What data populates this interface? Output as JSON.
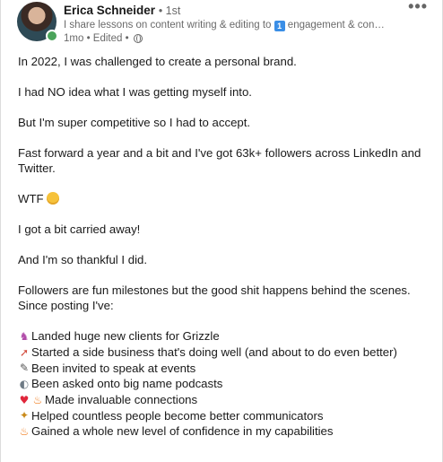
{
  "author": {
    "name": "Erica Schneider",
    "degree": "• 1st",
    "headline_prefix": "I share lessons on content writing & editing to ",
    "headline_badge": "1",
    "headline_suffix": " engagement & conver...",
    "timestamp": "1mo • Edited •",
    "more_label": "•••"
  },
  "post": {
    "paragraphs": [
      "In 2022, I was challenged to create a personal brand.",
      "I had NO idea what I was getting myself into.",
      "But I'm super competitive so I had to accept.",
      "Fast forward a year and a bit and I've got 63k+ followers across LinkedIn and Twitter.",
      "WTF",
      "I got a bit carried away!",
      "And I'm so thankful I did.",
      "Followers are fun milestones but the good shit happens behind the scenes. Since posting I've:"
    ],
    "list": [
      {
        "icon": "unicorn-icon",
        "text": "Landed huge new clients for Grizzle"
      },
      {
        "icon": "rocket-icon",
        "text": "Started a side business that's doing well (and about to do even better)"
      },
      {
        "icon": "microphone-icon",
        "text": "Been invited to speak at events"
      },
      {
        "icon": "podcast-icon",
        "text": "Been asked onto big name podcasts"
      },
      {
        "icon": "heart-fire-icon",
        "text": "Made invaluable connections"
      },
      {
        "icon": "party-popper-icon",
        "text": "Helped countless people become better communicators"
      },
      {
        "icon": "fire-icon",
        "text": "Gained a whole new level of confidence in my capabilities"
      }
    ]
  }
}
